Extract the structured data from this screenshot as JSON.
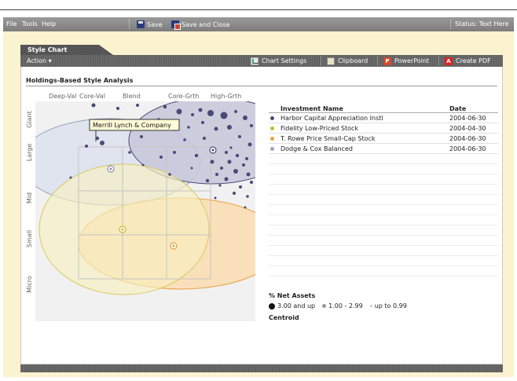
{
  "menu": {
    "file": "File",
    "tools": "Tools",
    "help": "Help",
    "save": "Save",
    "save_close": "Save and Close",
    "status": "Status: Text Here"
  },
  "tab": {
    "label": "Style Chart"
  },
  "actionbar": {
    "action": "Action ▾",
    "chart_settings": "Chart Settings",
    "clipboard": "Clipboard",
    "powerpoint": "PowerPoint",
    "create_pdf": "Create PDF"
  },
  "section_title": "Holdings-Based Style Analysis",
  "chart": {
    "col_labels": [
      "Deep-Val",
      "Core-Val",
      "Blend",
      "Core-Grth",
      "High-Grth"
    ],
    "row_labels": [
      "Giant",
      "Large",
      "Mid",
      "Small",
      "Micro"
    ],
    "tooltip": "Merrill Lynch & Company"
  },
  "list": {
    "col_name": "Investment Name",
    "col_date": "Date",
    "rows": [
      {
        "name": "Harbor Capital Appreciation Instl",
        "date": "2004-06-30",
        "color": "#4a4a78"
      },
      {
        "name": "Fidelity Low-Priced Stock",
        "date": "2004-04-30",
        "color": "#c8b830"
      },
      {
        "name": "T. Rowe Price Small-Cap Stock",
        "date": "2004-06-30",
        "color": "#e8a040"
      },
      {
        "name": "Dodge & Cox Balanced",
        "date": "2004-06-30",
        "color": "#9aa4c8"
      }
    ]
  },
  "legend": {
    "title": "% Net Assets",
    "item1": "3.00 and up",
    "item2": "1.00 - 2.99",
    "item3": "up to 0.99",
    "centroid": "Centroid"
  }
}
